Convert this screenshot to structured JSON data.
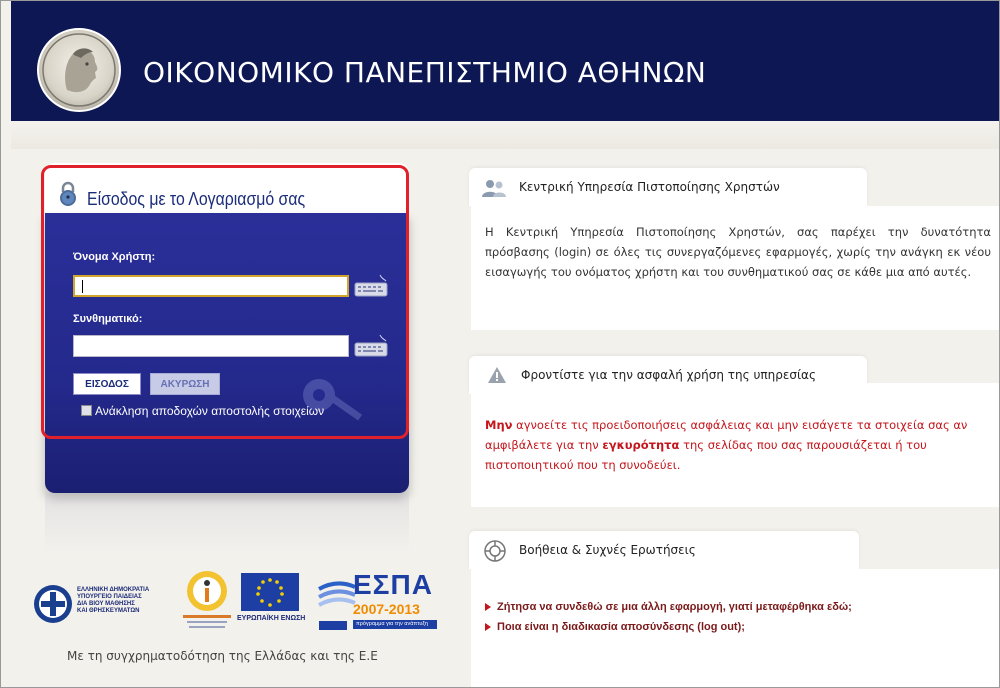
{
  "header": {
    "university_name": "ΟΙΚΟΝΟΜΙΚΟ ΠΑΝΕΠΙΣΤΗΜΙΟ ΑΘΗΝΩΝ"
  },
  "login": {
    "title": "Είσοδος με το Λογαριασμό σας",
    "username_label": "Όνομα Χρήστη:",
    "username_value": "",
    "password_label": "Συνθηματικό:",
    "password_value": "",
    "login_button": "ΕΙΣΟΔΟΣ",
    "cancel_button": "ΑΚΥΡΩΣΗ",
    "revoke_consent_label": "Ανάκληση αποδοχών αποστολής στοιχείων"
  },
  "sponsors": {
    "ministry_lines": [
      "ΕΛΛΗΝΙΚΗ ΔΗΜΟΚΡΑΤΙΑ",
      "ΥΠΟΥΡΓΕΙΟ ΠΑΙΔΕΙΑΣ",
      "ΔΙΑ ΒΙΟΥ ΜΑΘΗΣΗΣ",
      "ΚΑΙ ΘΡΗΣΚΕΥΜΑΤΩΝ"
    ],
    "eu_label": "ΕΥΡΩΠΑΪΚΗ ΕΝΩΣΗ",
    "espa_title": "ΕΣΠΑ",
    "espa_years": "2007-2013",
    "espa_subtitle": "πρόγραμμα για την ανάπτυξη",
    "footer_note": "Με τη συγχρηματοδότηση της Ελλάδας και της Ε.Ε"
  },
  "cards": {
    "auth": {
      "title": "Κεντρική Υπηρεσία Πιστοποίησης Χρηστών",
      "text": "Η Κεντρική Υπηρεσία Πιστοποίησης Χρηστών, σας παρέχει την δυνατότητα πρόσβασης (login) σε όλες τις συνεργαζόμενες εφαρμογές, χωρίς την ανάγκη εκ νέου εισαγωγής του ονόματος χρήστη και του συνθηματικού σας σε κάθε μια από αυτές."
    },
    "security": {
      "title": "Φροντίστε για την ασφαλή χρήση της υπηρεσίας",
      "text_bold1": "Μην",
      "text_part1": " αγνοείτε τις προειδοποιήσεις ασφάλειας και μην εισάγετε τα στοιχεία σας αν αμφιβάλετε για την ",
      "text_bold2": "εγκυρότητα",
      "text_part2": " της σελίδας που σας παρουσιάζεται ή του πιστοποιητικού που τη συνοδεύει."
    },
    "help": {
      "title": "Βοήθεια & Συχνές Ερωτήσεις",
      "links": [
        "Ζήτησα να συνδεθώ σε μια άλλη εφαρμογή, γιατί μεταφέρθηκα εδώ;",
        "Ποια είναι η διαδικασία αποσύνδεσης (log out);"
      ]
    }
  },
  "colors": {
    "header_bg": "#0d1754",
    "panel_blue": "#24298c",
    "alert_red": "#c4161c"
  }
}
